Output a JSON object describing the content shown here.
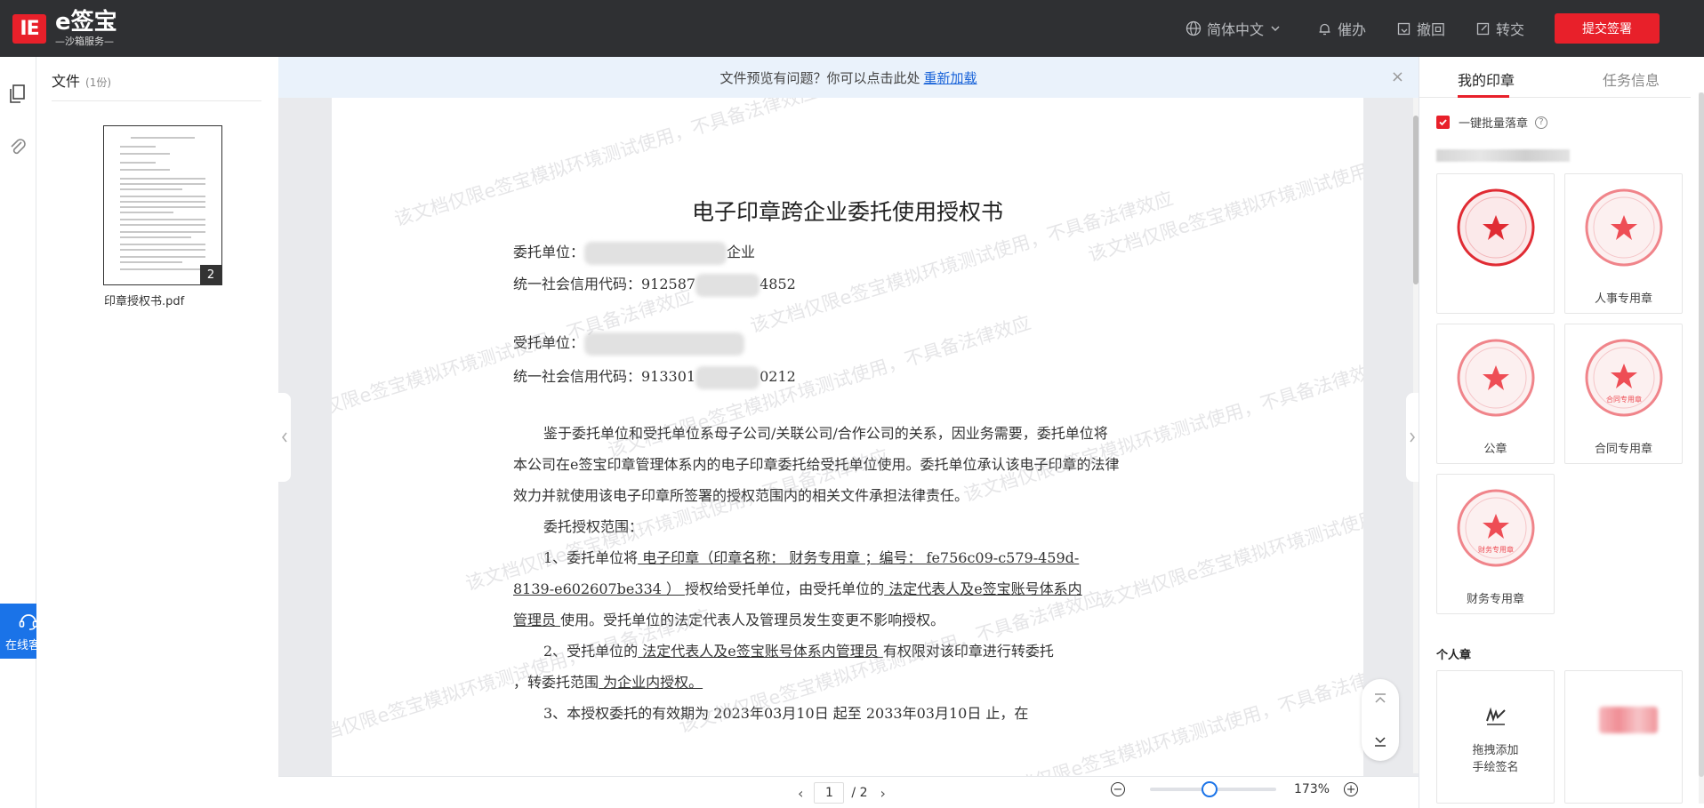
{
  "topbar": {
    "brand": "e签宝",
    "brand_sub": "—沙箱服务—",
    "logo_mark": "IE",
    "language": "简体中文",
    "remind": "催办",
    "revoke": "撤回",
    "transfer": "转交",
    "submit": "提交签署"
  },
  "files": {
    "title": "文件",
    "count": "(1份)",
    "items": [
      {
        "name": "印章授权书.pdf",
        "pages": "2"
      }
    ]
  },
  "support": {
    "label": "在线客服"
  },
  "notice": {
    "text": "文件预览有问题？你可以点击此处",
    "link": "重新加载",
    "close": "×"
  },
  "document": {
    "title": "电子印章跨企业委托使用授权书",
    "entrust_label": "委托单位：",
    "entrust_suffix": "企业",
    "code1_prefix": "统一社会信用代码：912587",
    "code1_suffix": "4852",
    "trustee_label": "受托单位：",
    "code2_prefix": "统一社会信用代码：913301",
    "code2_suffix": "0212",
    "para1_l1": "鉴于委托单位和受托单位系母子公司/关联公司/合作公司的关系，因业务需要，委托单位将",
    "para1_l2": "本公司在e签宝印章管理体系内的电子印章委托给受托单位使用。委托单位承认该电子印章的法律",
    "para1_l3": "效力并就使用该电子印章所签署的授权范围内的相关文件承担法律责任。",
    "scope": "委托授权范围：",
    "item1_a": "1、委托单位将",
    "item1_b": "    电子印章（印章名称：  财务专用章 ；编号：  fe756c09-c579-459d-",
    "item1_c": "8139-e602607be334 ）      ",
    "item1_d": "授权给受托单位，由受托单位的",
    "item1_e": "     法定代表人及e签宝账号体系内",
    "item1_f": "管理员     ",
    "item1_g": "使用。受托单位的法定代表人及管理员发生变更不影响授权。",
    "item2_a": "2、受托单位的",
    "item2_b": "     法定代表人及e签宝账号体系内管理员      ",
    "item2_c": "有权限对该印章进行转委托",
    "item2_d": "，转委托范围",
    "item2_e": "     为企业内授权。       ",
    "item3": "3、本授权委托的有效期为       2023年03月10日       起至       2033年03月10日       止，在",
    "watermark": "该文档仅限e签宝模拟环境测试使用，不具备法律效应"
  },
  "pager": {
    "current": "1",
    "total": "/ 2"
  },
  "zoom": {
    "value": "173%",
    "level_fraction": 0.47
  },
  "right": {
    "tab_active": "我的印章",
    "tab_inactive": "任务信息",
    "batch_label": "一键批量落章",
    "seals": [
      {
        "name": ""
      },
      {
        "name": "人事专用章"
      },
      {
        "name": "公章"
      },
      {
        "name": "合同专用章",
        "inner": "合同专用章"
      },
      {
        "name": "财务专用章",
        "inner": "财务专用章"
      }
    ],
    "personal_title": "个人章",
    "sig_add_l1": "拖拽添加",
    "sig_add_l2": "手绘签名"
  },
  "colors": {
    "accent": "#e8202a",
    "link": "#1a64d9",
    "support": "#1a73e8",
    "topbar": "#2f3033"
  }
}
